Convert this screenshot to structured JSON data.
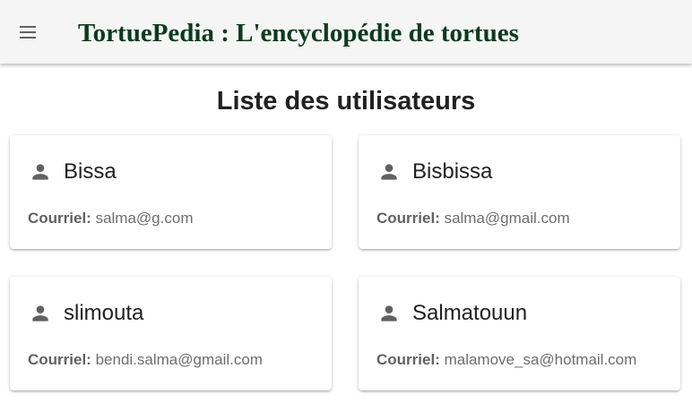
{
  "header": {
    "menu_icon": "menu-icon",
    "title": "TortuePedia : L'encyclopédie de tortues",
    "title_color": "#0b3b1d",
    "background": "#f5f5f5"
  },
  "page": {
    "title": "Liste des utilisateurs"
  },
  "users": [
    {
      "name": "Bissa",
      "email_label": "Courriel:",
      "email": "salma@g.com",
      "icon": "person-icon"
    },
    {
      "name": "Bisbissa",
      "email_label": "Courriel:",
      "email": "salma@gmail.com",
      "icon": "person-icon"
    },
    {
      "name": "slimouta",
      "email_label": "Courriel:",
      "email": "bendi.salma@gmail.com",
      "icon": "person-icon"
    },
    {
      "name": "Salmatouun",
      "email_label": "Courriel:",
      "email": "malamove_sa@hotmail.com",
      "icon": "person-icon"
    }
  ]
}
